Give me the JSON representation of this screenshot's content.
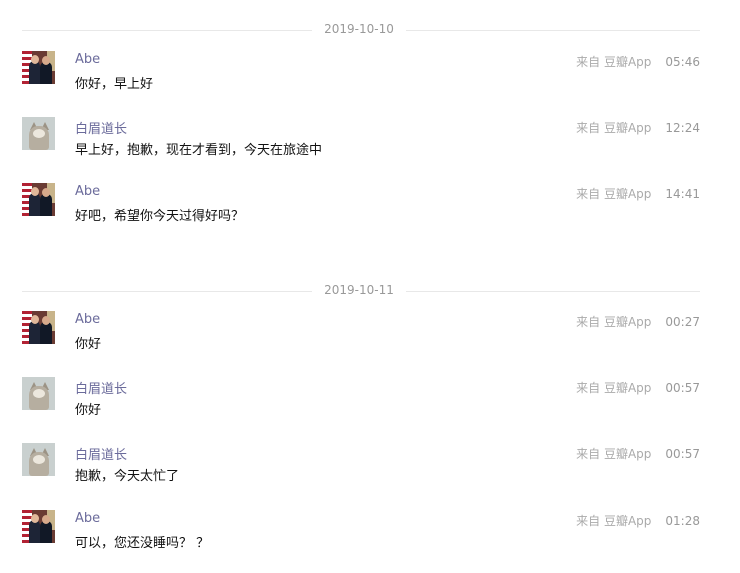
{
  "groups": [
    {
      "date": "2019-10-10",
      "messages": [
        {
          "sender": "Abe",
          "text": "你好，早上好",
          "source": "来自 豆瓣App",
          "time": "05:46"
        },
        {
          "sender": "白眉道长",
          "text": "早上好，抱歉，现在才看到，今天在旅途中",
          "source": "来自 豆瓣App",
          "time": "12:24"
        },
        {
          "sender": "Abe",
          "text": "好吧，希望你今天过得好吗？",
          "source": "来自 豆瓣App",
          "time": "14:41"
        }
      ]
    },
    {
      "date": "2019-10-11",
      "messages": [
        {
          "sender": "Abe",
          "text": "你好",
          "source": "来自 豆瓣App",
          "time": "00:27"
        },
        {
          "sender": "白眉道长",
          "text": "你好",
          "source": "来自 豆瓣App",
          "time": "00:57"
        },
        {
          "sender": "白眉道长",
          "text": "抱歉，今天太忙了",
          "source": "来自 豆瓣App",
          "time": "00:57"
        },
        {
          "sender": "Abe",
          "text": "可以，您还没睡吗？ ？",
          "source": "来自 豆瓣App",
          "time": "01:28"
        }
      ]
    }
  ]
}
